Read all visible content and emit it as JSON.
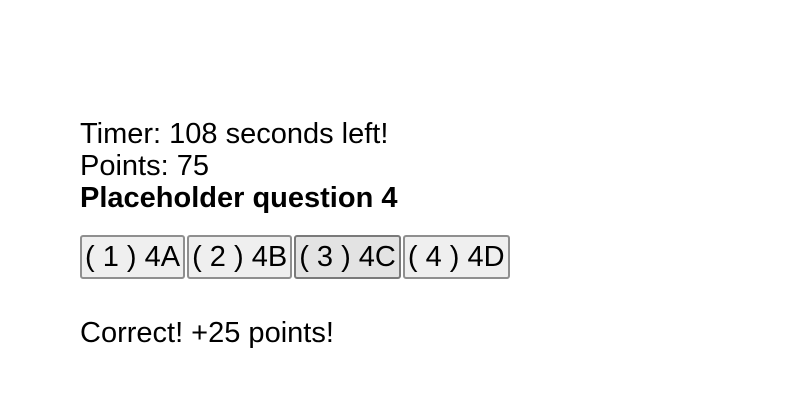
{
  "status": {
    "timer": "Timer: 108 seconds left!",
    "points": "Points: 75"
  },
  "question": {
    "text": "Placeholder question 4"
  },
  "choices": [
    {
      "label": "( 1 ) 4A"
    },
    {
      "label": "( 2 ) 4B"
    },
    {
      "label": "( 3 ) 4C"
    },
    {
      "label": "( 4 ) 4D"
    }
  ],
  "feedback": {
    "message": "Correct! +25 points!"
  }
}
